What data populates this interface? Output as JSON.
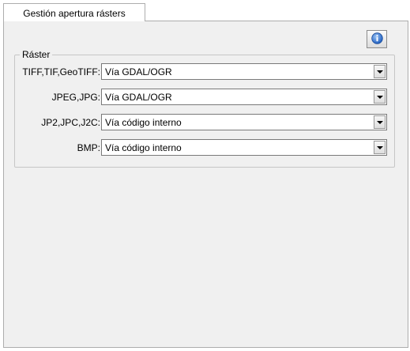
{
  "tab": {
    "label": "Gestión apertura rásters"
  },
  "group": {
    "legend": "Ráster"
  },
  "rows": [
    {
      "label": "TIFF,TIF,GeoTIFF:",
      "value": "Vía GDAL/OGR"
    },
    {
      "label": "JPEG,JPG:",
      "value": "Vía GDAL/OGR"
    },
    {
      "label": "JP2,JPC,J2C:",
      "value": "Vía código interno"
    },
    {
      "label": "BMP:",
      "value": "Vía código interno"
    }
  ],
  "icons": {
    "info": "info-icon"
  },
  "colors": {
    "panel_bg": "#f0f0f0",
    "info_blue": "#2f6fce"
  }
}
